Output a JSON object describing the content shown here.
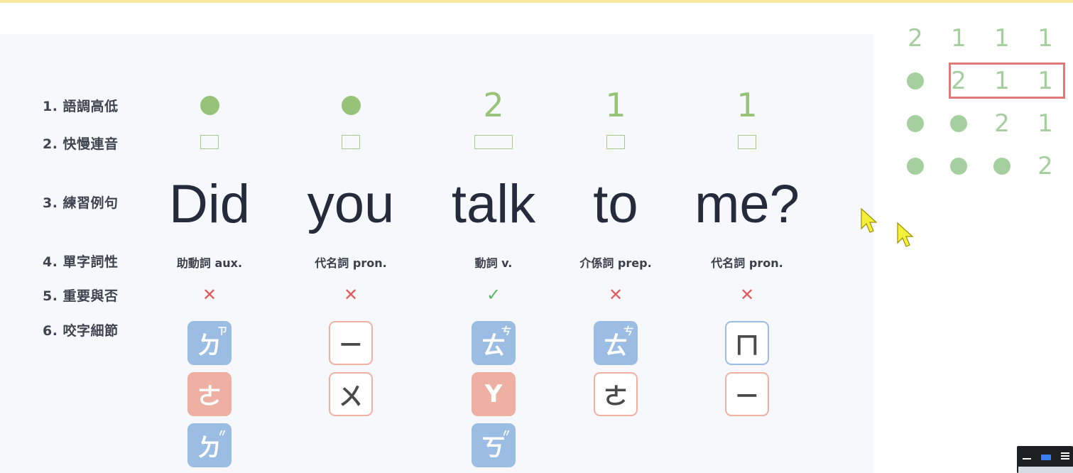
{
  "row_labels": [
    "1. 語調高低",
    "2. 快慢連音",
    "3. 練習例句",
    "4. 單字詞性",
    "5. 重要與否",
    "6. 咬字細節"
  ],
  "words": [
    {
      "tone": "",
      "tone_type": "dot",
      "word": "Did",
      "pos": "助動詞 aux.",
      "important": "✕",
      "tiles": [
        {
          "char": "ㄉ",
          "sup": "ㄗ",
          "style": "blue"
        },
        {
          "char": "ㄜ",
          "sup": "",
          "style": "pink"
        },
        {
          "char": "ㄉ",
          "sup": "〃",
          "style": "blue"
        }
      ]
    },
    {
      "tone": "",
      "tone_type": "dot",
      "word": "you",
      "pos": "代名詞 pron.",
      "important": "✕",
      "tiles": [
        {
          "char": "ㄧ",
          "sup": "",
          "style": "outline-pink"
        },
        {
          "char": "ㄨ",
          "sup": "",
          "style": "outline-pink"
        }
      ]
    },
    {
      "tone": "2",
      "tone_type": "num",
      "word": "talk",
      "pos": "動詞 v.",
      "important": "✓",
      "tiles": [
        {
          "char": "ㄊ",
          "sup": "ㄘ",
          "style": "blue"
        },
        {
          "char": "Y",
          "sup": "",
          "style": "pink"
        },
        {
          "char": "ㄎ",
          "sup": "〃",
          "style": "blue"
        }
      ]
    },
    {
      "tone": "1",
      "tone_type": "num",
      "word": "to",
      "pos": "介係詞 prep.",
      "important": "✕",
      "tiles": [
        {
          "char": "ㄊ",
          "sup": "ㄘ",
          "style": "blue"
        },
        {
          "char": "ㄜ",
          "sup": "",
          "style": "outline-pink"
        }
      ]
    },
    {
      "tone": "1",
      "tone_type": "num",
      "word": "me?",
      "pos": "代名詞 pron.",
      "important": "✕",
      "tiles": [
        {
          "char": "ㄇ",
          "sup": "",
          "style": "outline-blue"
        },
        {
          "char": "ㄧ",
          "sup": "",
          "style": "outline-pink"
        }
      ]
    }
  ],
  "side_grid": [
    [
      "2",
      "1",
      "1",
      "1"
    ],
    [
      "dot",
      "2",
      "1",
      "1"
    ],
    [
      "dot",
      "dot",
      "2",
      "1"
    ],
    [
      "dot",
      "dot",
      "dot",
      "2"
    ]
  ],
  "colors": {
    "dot_green": "#97c379",
    "wrong": "#e25a5a",
    "right": "#5ab865",
    "highlight": "#e07a7a"
  }
}
